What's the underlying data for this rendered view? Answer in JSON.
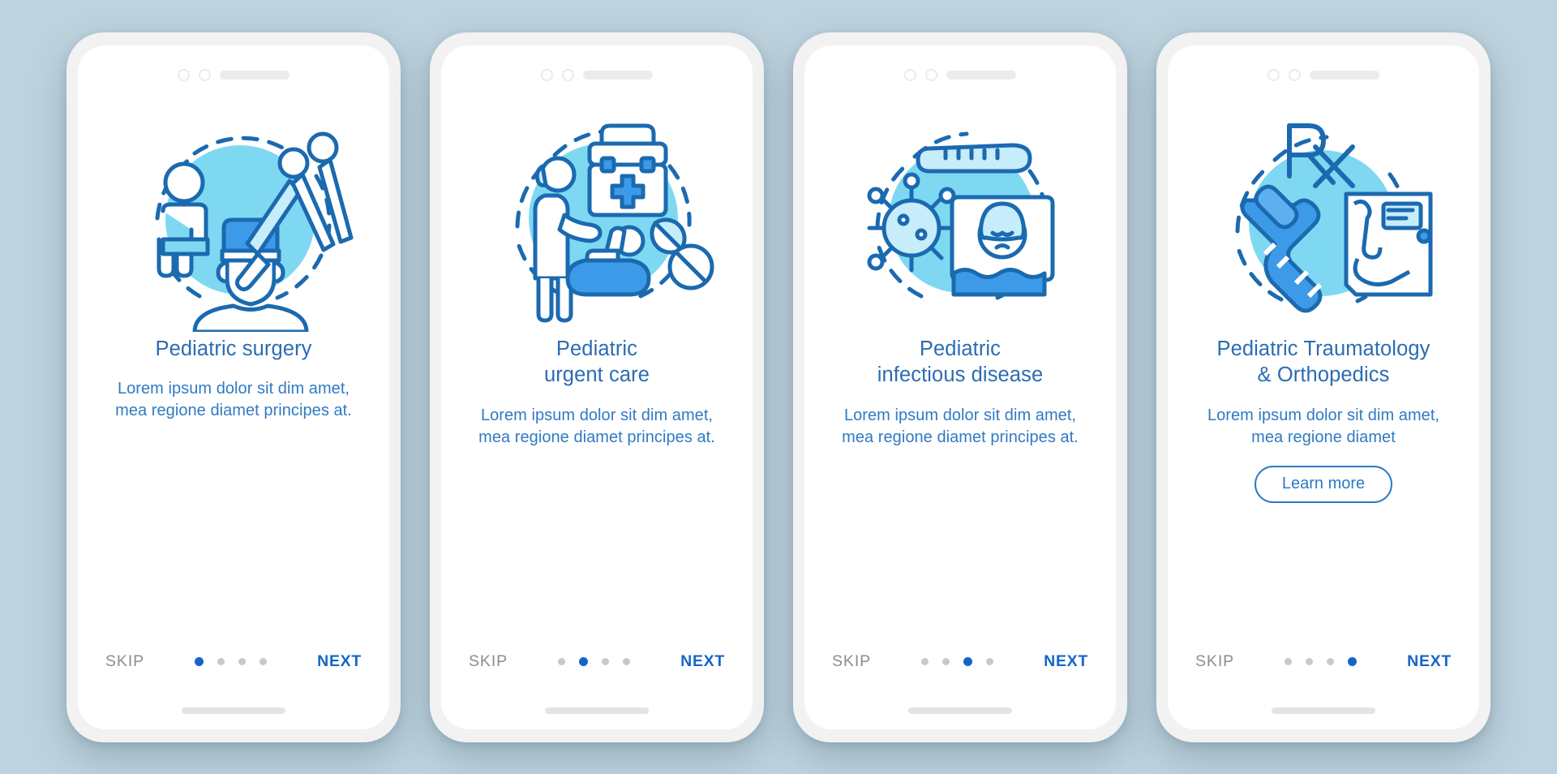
{
  "theme": {
    "page_background": "#bed3de",
    "accent_blue": "#1565c8",
    "title_blue": "#2b6cb3",
    "body_blue": "#2f7ac4",
    "icon_dark_blue": "#1b6ab0",
    "icon_light_blue": "#7fd8f2",
    "icon_mid_blue": "#3d9ae8",
    "inactive_dot": "#c9c9c9",
    "skip_gray": "#8d8d8d"
  },
  "common": {
    "skip_label": "SKIP",
    "next_label": "NEXT",
    "body_text": "Lorem ipsum dolor sit dim amet, mea regione diamet principes at.",
    "total_dots": 4
  },
  "screens": [
    {
      "id": "pediatric-surgery",
      "title": "Pediatric surgery",
      "title_lines": [
        "Pediatric surgery"
      ],
      "body": "Lorem ipsum dolor sit dim amet, mea regione diamet principes at.",
      "skip_label": "SKIP",
      "next_label": "NEXT",
      "active_dot": 1,
      "has_learn_more": false,
      "learn_more_label": "",
      "illustration": "surgery-illustration"
    },
    {
      "id": "pediatric-urgent-care",
      "title": "Pediatric urgent care",
      "title_lines": [
        "Pediatric",
        "urgent care"
      ],
      "body": "Lorem ipsum dolor sit dim amet, mea regione diamet principes at.",
      "skip_label": "SKIP",
      "next_label": "NEXT",
      "active_dot": 2,
      "has_learn_more": false,
      "learn_more_label": "",
      "illustration": "urgent-care-illustration"
    },
    {
      "id": "pediatric-infectious-disease",
      "title": "Pediatric infectious disease",
      "title_lines": [
        "Pediatric",
        "infectious disease"
      ],
      "body": "Lorem ipsum dolor sit dim amet, mea regione diamet principes at.",
      "skip_label": "SKIP",
      "next_label": "NEXT",
      "active_dot": 3,
      "has_learn_more": false,
      "learn_more_label": "",
      "illustration": "infectious-disease-illustration"
    },
    {
      "id": "pediatric-traumatology-orthopedics",
      "title": "Pediatric Traumatology & Orthopedics",
      "title_lines": [
        "Pediatric Traumatology",
        "& Orthopedics"
      ],
      "body": "Lorem ipsum dolor sit dim amet, mea regione diamet",
      "skip_label": "SKIP",
      "next_label": "NEXT",
      "active_dot": 4,
      "has_learn_more": true,
      "learn_more_label": "Learn more",
      "illustration": "orthopedics-illustration"
    }
  ]
}
